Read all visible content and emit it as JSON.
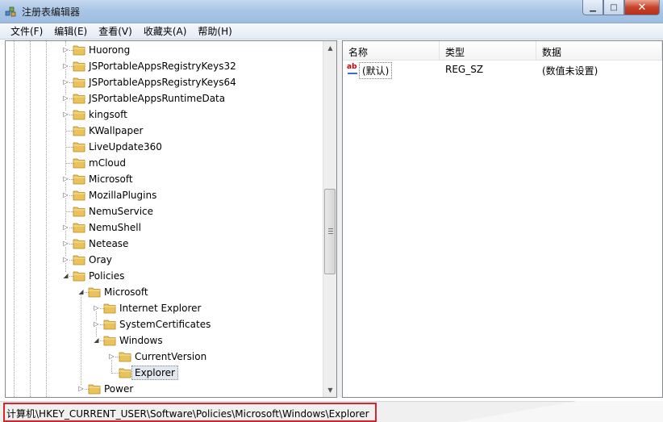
{
  "window": {
    "title": "注册表编辑器",
    "controls": {
      "minimize": "▁",
      "maximize": "□",
      "close": "✕"
    }
  },
  "menu": [
    "文件(F)",
    "编辑(E)",
    "查看(V)",
    "收藏夹(A)",
    "帮助(H)"
  ],
  "tree": {
    "items": [
      {
        "label": "Huorong",
        "expandable": true,
        "expanded": false
      },
      {
        "label": "JSPortableAppsRegistryKeys32",
        "expandable": true,
        "expanded": false
      },
      {
        "label": "JSPortableAppsRegistryKeys64",
        "expandable": true,
        "expanded": false
      },
      {
        "label": "JSPortableAppsRuntimeData",
        "expandable": true,
        "expanded": false
      },
      {
        "label": "kingsoft",
        "expandable": true,
        "expanded": false
      },
      {
        "label": "KWallpaper",
        "expandable": false,
        "expanded": false
      },
      {
        "label": "LiveUpdate360",
        "expandable": false,
        "expanded": false
      },
      {
        "label": "mCloud",
        "expandable": false,
        "expanded": false
      },
      {
        "label": "Microsoft",
        "expandable": true,
        "expanded": false
      },
      {
        "label": "MozillaPlugins",
        "expandable": true,
        "expanded": false
      },
      {
        "label": "NemuService",
        "expandable": false,
        "expanded": false
      },
      {
        "label": "NemuShell",
        "expandable": true,
        "expanded": false
      },
      {
        "label": "Netease",
        "expandable": true,
        "expanded": false
      },
      {
        "label": "Oray",
        "expandable": true,
        "expanded": false
      },
      {
        "label": "Policies",
        "expandable": true,
        "expanded": true
      },
      {
        "label": "Microsoft",
        "expandable": true,
        "expanded": true
      },
      {
        "label": "Internet Explorer",
        "expandable": true,
        "expanded": false
      },
      {
        "label": "SystemCertificates",
        "expandable": true,
        "expanded": false
      },
      {
        "label": "Windows",
        "expandable": true,
        "expanded": true
      },
      {
        "label": "CurrentVersion",
        "expandable": true,
        "expanded": false
      },
      {
        "label": "Explorer",
        "expandable": false,
        "expanded": false,
        "selected": true
      },
      {
        "label": "Power",
        "expandable": true,
        "expanded": false
      }
    ]
  },
  "values": {
    "columns": [
      "名称",
      "类型",
      "数据"
    ],
    "rows": [
      {
        "name": "(默认)",
        "type": "REG_SZ",
        "data": "(数值未设置)"
      }
    ]
  },
  "status": {
    "path": "计算机\\HKEY_CURRENT_USER\\Software\\Policies\\Microsoft\\Windows\\Explorer"
  },
  "colors": {
    "highlight_box": "#d8252b",
    "folder": "#e8c15a",
    "title_bar": "#aac6e6"
  }
}
